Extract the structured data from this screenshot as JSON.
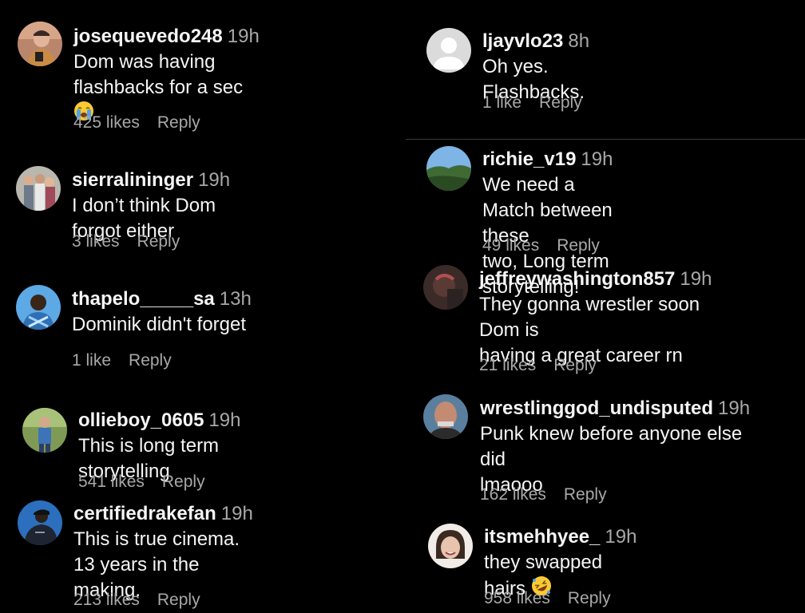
{
  "comments_left": [
    {
      "user": "josequevedo248",
      "time": "19h",
      "text": "Dom was having flashbacks for a sec",
      "emoji": "crying-face-icon",
      "likes": "425 likes",
      "reply": "Reply"
    },
    {
      "user": "sierralininger",
      "time": "19h",
      "text": "I don’t think Dom forgot either",
      "likes": "3 likes",
      "reply": "Reply"
    },
    {
      "user": "thapelo_____sa",
      "time": "13h",
      "text": "Dominik didn't forget",
      "likes": "1 like",
      "reply": "Reply"
    },
    {
      "user": "ollieboy_0605",
      "time": "19h",
      "text": "This is long term storytelling",
      "likes": "541 likes",
      "reply": "Reply"
    },
    {
      "user": "certifiedrakefan",
      "time": "19h",
      "text_line1": "This is true cinema. 13 years in the",
      "text_line2": "making.",
      "likes": "213 likes",
      "reply": "Reply"
    }
  ],
  "comments_right": [
    {
      "user": "ljayvlo23",
      "time": "8h",
      "text": "Oh yes. Flashbacks.",
      "likes": "1 like",
      "reply": "Reply"
    },
    {
      "user": "richie_v19",
      "time": "19h",
      "text_line1": "We need a Match between these",
      "text_line2": "two, Long term storytelling!",
      "likes": "49 likes",
      "reply": "Reply"
    },
    {
      "user": "jeffreywashington857",
      "time": "19h",
      "text_line1": "They gonna wrestler soon Dom is",
      "text_line2": "having a great career rn",
      "likes": "21 likes",
      "reply": "Reply"
    },
    {
      "user": "wrestlinggod_undisputed",
      "time": "19h",
      "text_line1": "Punk knew before anyone else did",
      "text_line2": "lmaooo",
      "likes": "162 likes",
      "reply": "Reply"
    },
    {
      "user": "itsmehhyee_",
      "time": "19h",
      "text": "they swapped hairs",
      "emoji": "rolling-laughing-icon",
      "likes": "958 likes",
      "reply": "Reply"
    }
  ],
  "colors": {
    "background": "#000000",
    "text": "#f5f5f5",
    "muted": "#a8a8a8",
    "divider": "#3a3a3a"
  }
}
